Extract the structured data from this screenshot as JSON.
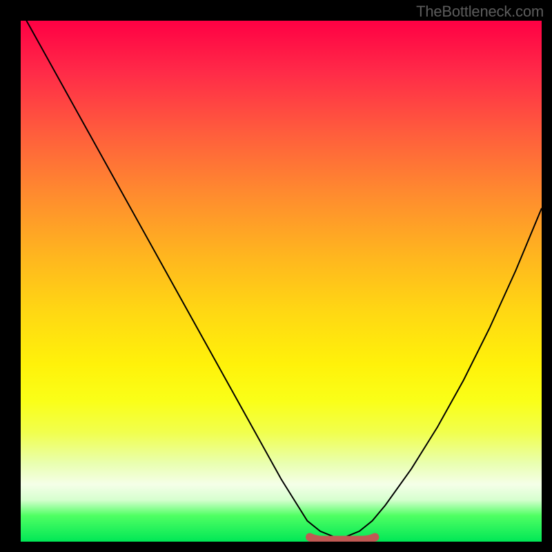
{
  "watermark": "TheBottleneck.com",
  "colors": {
    "frame": "#000000",
    "watermark": "#5c5c5c",
    "trace": "#000000",
    "highlight": "#c15a54",
    "gradient_top": "#ff0044",
    "gradient_bottom": "#00e756"
  },
  "chart_data": {
    "type": "line",
    "title": "",
    "xlabel": "",
    "ylabel": "",
    "xlim": [
      0,
      1
    ],
    "ylim": [
      0,
      1
    ],
    "series": [
      {
        "name": "bottleneck-curve",
        "x": [
          0.0,
          0.05,
          0.1,
          0.15,
          0.2,
          0.25,
          0.3,
          0.35,
          0.4,
          0.45,
          0.5,
          0.525,
          0.55,
          0.575,
          0.6,
          0.625,
          0.65,
          0.675,
          0.7,
          0.75,
          0.8,
          0.85,
          0.9,
          0.95,
          1.0
        ],
        "y": [
          1.02,
          0.93,
          0.84,
          0.75,
          0.66,
          0.57,
          0.48,
          0.39,
          0.3,
          0.21,
          0.12,
          0.08,
          0.04,
          0.02,
          0.01,
          0.01,
          0.02,
          0.04,
          0.07,
          0.14,
          0.22,
          0.31,
          0.41,
          0.52,
          0.64
        ]
      }
    ],
    "highlight_region": {
      "x_start": 0.555,
      "x_end": 0.68,
      "y": 0.01
    }
  }
}
